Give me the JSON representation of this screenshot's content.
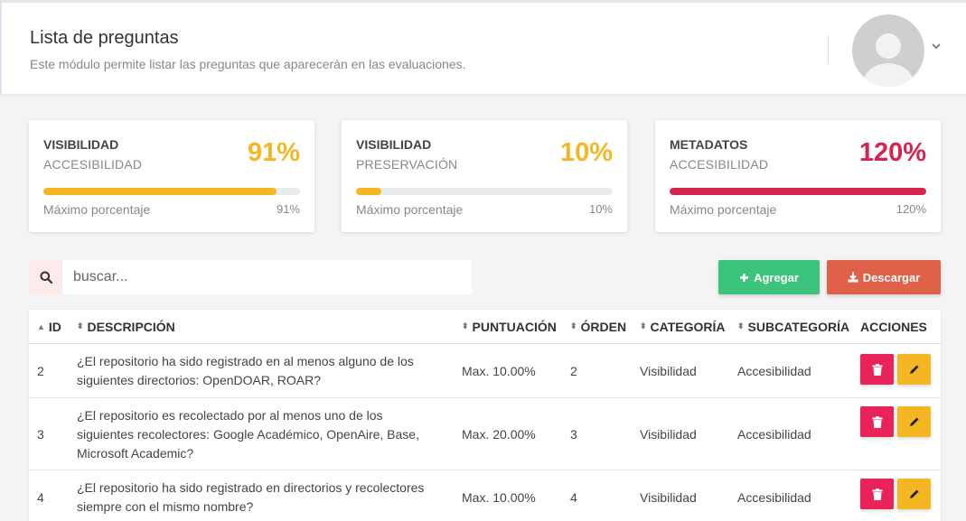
{
  "header": {
    "title": "Lista de preguntas",
    "subtitle": "Este módulo permite listar las preguntas que aparecerán en las evaluaciones."
  },
  "cards": [
    {
      "title": "VISIBILIDAD",
      "subtitle": "ACCESIBILIDAD",
      "value": "91%",
      "percent": 91,
      "foot_label": "Máximo porcentaje",
      "foot_value": "91%",
      "color": "#f5b623"
    },
    {
      "title": "VISIBILIDAD",
      "subtitle": "PRESERVACIÓN",
      "value": "10%",
      "percent": 10,
      "foot_label": "Máximo porcentaje",
      "foot_value": "10%",
      "color": "#f5b623"
    },
    {
      "title": "METADATOS",
      "subtitle": "ACCESIBILIDAD",
      "value": "120%",
      "percent": 100,
      "foot_label": "Máximo porcentaje",
      "foot_value": "120%",
      "color": "#d6244f"
    }
  ],
  "search": {
    "placeholder": "buscar..."
  },
  "toolbar": {
    "add_label": "Agregar",
    "download_label": "Descargar"
  },
  "table": {
    "headers": {
      "id": "ID",
      "description": "DESCRIPCIÓN",
      "score": "PUNTUACIÓN",
      "order": "ÓRDEN",
      "category": "CATEGORÍA",
      "subcategory": "SUBCATEGORÍA",
      "actions": "ACCIONES"
    },
    "rows": [
      {
        "id": "2",
        "description": "¿El repositorio ha sido registrado en al menos alguno de los siguientes directorios: OpenDOAR, ROAR?",
        "score": "Max. 10.00%",
        "order": "2",
        "category": "Visibilidad",
        "subcategory": "Accesibilidad"
      },
      {
        "id": "3",
        "description": "¿El repositorio es recolectado por al menos uno de los siguientes recolectores: Google Académico, OpenAire, Base, Microsoft Academic?",
        "score": "Max. 20.00%",
        "order": "3",
        "category": "Visibilidad",
        "subcategory": "Accesibilidad"
      },
      {
        "id": "4",
        "description": "¿El repositorio ha sido registrado en directorios y recolectores siempre con el mismo nombre?",
        "score": "Max. 10.00%",
        "order": "4",
        "category": "Visibilidad",
        "subcategory": "Accesibilidad"
      }
    ]
  },
  "icons": {
    "search": "search-icon",
    "add": "plus-icon",
    "download": "download-icon",
    "delete": "trash-icon",
    "edit": "pencil-icon",
    "avatar": "user-avatar",
    "menu": "chevron-down-icon"
  },
  "colors": {
    "add": "#3cc47c",
    "download": "#e0614a",
    "delete": "#e8235a",
    "edit": "#f5b623"
  }
}
